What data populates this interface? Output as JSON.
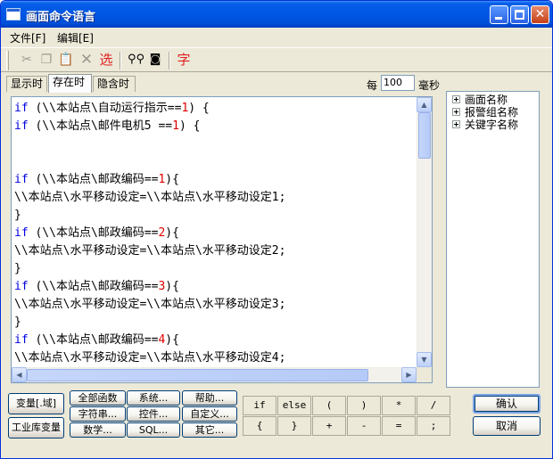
{
  "window": {
    "title": "画面命令语言"
  },
  "menu": {
    "file": "文件[F]",
    "edit": "编辑[E]"
  },
  "toolbar": {
    "icons": [
      "cut-icon",
      "copy-icon",
      "paste-icon",
      "delete-icon",
      "select-icon",
      "find-icon",
      "replace-icon",
      "font-icon"
    ],
    "select_label": "选",
    "font_label": "字"
  },
  "tabs": [
    {
      "label": "显示时"
    },
    {
      "label": "存在时"
    },
    {
      "label": "隐含时"
    }
  ],
  "interval": {
    "prefix": "每",
    "value": "100",
    "unit": "毫秒"
  },
  "editor": {
    "lines": [
      [
        {
          "t": "if ",
          "c": "kw"
        },
        {
          "t": "(\\\\本站点\\自动运行指示==",
          "c": "txt"
        },
        {
          "t": "1",
          "c": "num"
        },
        {
          "t": ") {",
          "c": "txt"
        }
      ],
      [
        {
          "t": "if ",
          "c": "kw"
        },
        {
          "t": "(\\\\本站点\\邮件电机5 ==",
          "c": "txt"
        },
        {
          "t": "1",
          "c": "num"
        },
        {
          "t": ") {",
          "c": "txt"
        }
      ],
      [],
      [],
      [
        {
          "t": "if ",
          "c": "kw"
        },
        {
          "t": "(\\\\本站点\\邮政编码==",
          "c": "txt"
        },
        {
          "t": "1",
          "c": "num"
        },
        {
          "t": "){",
          "c": "txt"
        }
      ],
      [
        {
          "t": "\\\\本站点\\水平移动设定=\\\\本站点\\水平移动设定1;",
          "c": "txt"
        }
      ],
      [
        {
          "t": "}",
          "c": "txt"
        }
      ],
      [
        {
          "t": "if ",
          "c": "kw"
        },
        {
          "t": "(\\\\本站点\\邮政编码==",
          "c": "txt"
        },
        {
          "t": "2",
          "c": "num"
        },
        {
          "t": "){",
          "c": "txt"
        }
      ],
      [
        {
          "t": "\\\\本站点\\水平移动设定=\\\\本站点\\水平移动设定2;",
          "c": "txt"
        }
      ],
      [
        {
          "t": "}",
          "c": "txt"
        }
      ],
      [
        {
          "t": "if ",
          "c": "kw"
        },
        {
          "t": "(\\\\本站点\\邮政编码==",
          "c": "txt"
        },
        {
          "t": "3",
          "c": "num"
        },
        {
          "t": "){",
          "c": "txt"
        }
      ],
      [
        {
          "t": "\\\\本站点\\水平移动设定=\\\\本站点\\水平移动设定3;",
          "c": "txt"
        }
      ],
      [
        {
          "t": "}",
          "c": "txt"
        }
      ],
      [
        {
          "t": "if ",
          "c": "kw"
        },
        {
          "t": "(\\\\本站点\\邮政编码==",
          "c": "txt"
        },
        {
          "t": "4",
          "c": "num"
        },
        {
          "t": "){",
          "c": "txt"
        }
      ],
      [
        {
          "t": "\\\\本站点\\水平移动设定=\\\\本站点\\水平移动设定4;",
          "c": "txt"
        }
      ]
    ]
  },
  "tree": {
    "items": [
      {
        "label": "画面名称"
      },
      {
        "label": "报警组名称"
      },
      {
        "label": "关键字名称"
      }
    ]
  },
  "buttons": {
    "variable_field": "变量[.域]",
    "industrial_db_var": "工业库变量",
    "all_functions": "全部函数",
    "system": "系统...",
    "help": "帮助...",
    "string": "字符串...",
    "control": "控件...",
    "custom": "自定义...",
    "math": "数学...",
    "sql": "SQL...",
    "other": "其它...",
    "confirm": "确认",
    "cancel": "取消"
  },
  "operators": {
    "row1": [
      "if",
      "else",
      "(",
      ")",
      "*",
      "/"
    ],
    "row2": [
      "{",
      "}",
      "+",
      "-",
      "=",
      ";"
    ]
  }
}
